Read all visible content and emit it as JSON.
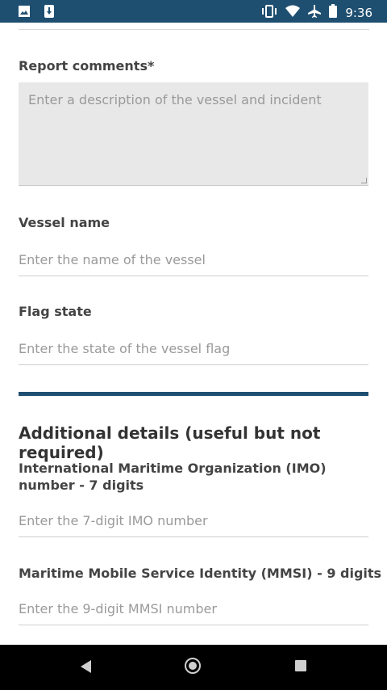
{
  "status_bar": {
    "time": "9:36",
    "left_icons": [
      "image-icon",
      "download-icon"
    ],
    "right_icons": [
      "vibrate-icon",
      "wifi-icon",
      "airplane-icon",
      "battery-icon"
    ],
    "background_color": "#1f4f70"
  },
  "form": {
    "report_comments": {
      "label": "Report comments*",
      "placeholder": "Enter a description of the vessel and incident"
    },
    "vessel_name": {
      "label": "Vessel name",
      "placeholder": "Enter the name of the vessel"
    },
    "flag_state": {
      "label": "Flag state",
      "placeholder": "Enter the state of the vessel flag"
    },
    "additional": {
      "title": "Additional details (useful but not required)",
      "imo": {
        "label": "International Maritime Organization (IMO) number - 7 digits",
        "placeholder": "Enter the 7-digit IMO number"
      },
      "mmsi": {
        "label": "Maritime Mobile Service Identity (MMSI) - 9 digits",
        "placeholder": "Enter the 9-digit MMSI number"
      }
    }
  },
  "nav_bar": {
    "buttons": [
      "back-icon",
      "home-icon",
      "recent-apps-icon"
    ]
  }
}
